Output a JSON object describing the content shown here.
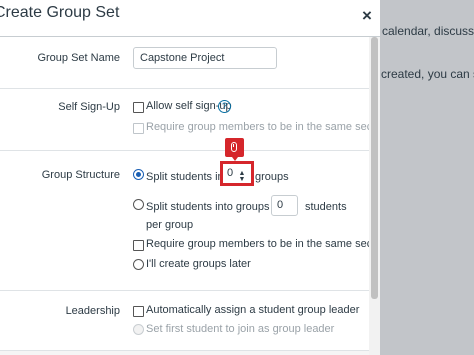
{
  "background": {
    "line1": "calendar, discussion",
    "line2": "created, you can set"
  },
  "modal": {
    "title": "Create Group Set",
    "close_label": "×"
  },
  "group_set_name": {
    "label": "Group Set Name",
    "value": "Capstone Project"
  },
  "self_signup": {
    "label": "Self Sign-Up",
    "allow_label": "Allow self sign-up",
    "allow_checked": false,
    "require_section_label": "Require group members to be in the same section",
    "require_section_enabled": false,
    "help_glyph": "?"
  },
  "group_structure": {
    "label": "Group Structure",
    "split_prefix": "Split students into",
    "split_count": "0",
    "split_suffix": "groups",
    "split_selected": true,
    "per_group_prefix": "Split students into groups with",
    "per_group_count": "0",
    "per_group_suffix": "students",
    "per_group_line2": "per group",
    "require_section_label": "Require group members to be in the same section",
    "create_later_label": "I'll create groups later"
  },
  "leadership": {
    "label": "Leadership",
    "auto_assign_label": "Automatically assign a student group leader",
    "first_student_label": "Set first student to join as group leader"
  },
  "colors": {
    "highlight": "#d5262b",
    "accent": "#1a5fb4"
  },
  "icons": {
    "close": "close-icon",
    "help": "question-circle-icon",
    "click_marker": "mouse-click-icon",
    "spinner": "stepper-arrows-icon"
  }
}
